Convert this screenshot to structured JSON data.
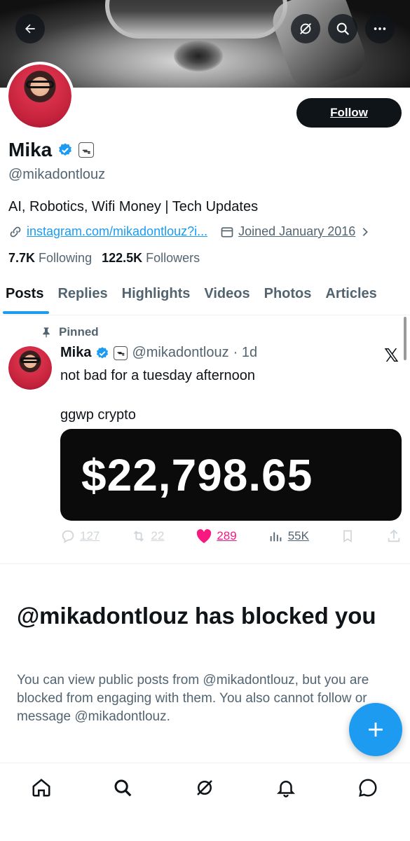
{
  "banner": {
    "description_icons": [
      "back-arrow-icon",
      "grok-icon",
      "search-icon",
      "more-icon"
    ]
  },
  "profile": {
    "follow_label": "Follow",
    "name": "Mika",
    "handle": "@mikadontlouz",
    "emoji": "ᯓ",
    "bio": "AI, Robotics, Wifi Money | Tech Updates",
    "link": "instagram.com/mikadontlouz?i...",
    "joined": "Joined January 2016",
    "following_count": "7.7K",
    "following_label": "Following",
    "followers_count": "122.5K",
    "followers_label": "Followers"
  },
  "tabs": [
    {
      "label": "Posts"
    },
    {
      "label": "Replies"
    },
    {
      "label": "Highlights"
    },
    {
      "label": "Videos"
    },
    {
      "label": "Photos"
    },
    {
      "label": "Articles"
    }
  ],
  "post": {
    "pinned_label": "Pinned",
    "name": "Mika",
    "handle": "@mikadontlouz",
    "time": "· 1d",
    "line1": "not bad for a tuesday afternoon",
    "line2": "ggwp crypto",
    "card_amount": "$22,798.65",
    "replies": "127",
    "reposts": "22",
    "likes": "289",
    "views": "55K"
  },
  "blocked": {
    "title": "@mikadontlouz has blocked you",
    "text": "You can view public posts from @mikadontlouz, but you are blocked from engaging with them. You also cannot follow or message @mikadontlouz."
  },
  "colors": {
    "accent": "#1d9bf0",
    "like": "#f91880",
    "text": "#0f1419",
    "muted": "#536471"
  }
}
